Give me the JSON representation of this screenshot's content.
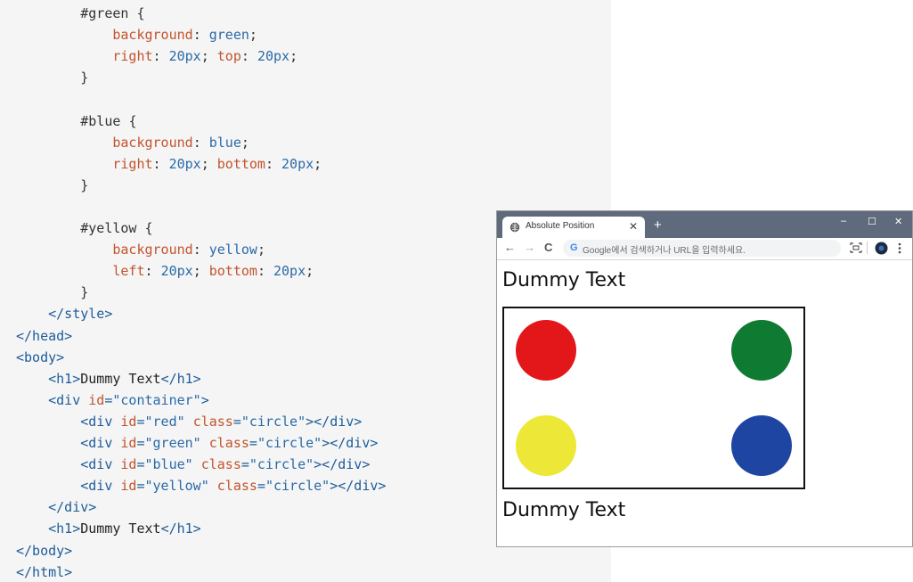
{
  "code": {
    "lines": [
      [
        [
          "tok-sel",
          "        #green "
        ],
        [
          "tok-punc",
          "{"
        ]
      ],
      [
        [
          "tok-prop",
          "            background"
        ],
        [
          "tok-punc",
          ": "
        ],
        [
          "tok-val",
          "green"
        ],
        [
          "tok-punc",
          ";"
        ]
      ],
      [
        [
          "tok-prop",
          "            right"
        ],
        [
          "tok-punc",
          ": "
        ],
        [
          "tok-val",
          "20px"
        ],
        [
          "tok-punc",
          "; "
        ],
        [
          "tok-prop",
          "top"
        ],
        [
          "tok-punc",
          ": "
        ],
        [
          "tok-val",
          "20px"
        ],
        [
          "tok-punc",
          ";"
        ]
      ],
      [
        [
          "tok-punc",
          "        }"
        ]
      ],
      [
        [
          "tok-punc",
          ""
        ]
      ],
      [
        [
          "tok-sel",
          "        #blue "
        ],
        [
          "tok-punc",
          "{"
        ]
      ],
      [
        [
          "tok-prop",
          "            background"
        ],
        [
          "tok-punc",
          ": "
        ],
        [
          "tok-val",
          "blue"
        ],
        [
          "tok-punc",
          ";"
        ]
      ],
      [
        [
          "tok-prop",
          "            right"
        ],
        [
          "tok-punc",
          ": "
        ],
        [
          "tok-val",
          "20px"
        ],
        [
          "tok-punc",
          "; "
        ],
        [
          "tok-prop",
          "bottom"
        ],
        [
          "tok-punc",
          ": "
        ],
        [
          "tok-val",
          "20px"
        ],
        [
          "tok-punc",
          ";"
        ]
      ],
      [
        [
          "tok-punc",
          "        }"
        ]
      ],
      [
        [
          "tok-punc",
          ""
        ]
      ],
      [
        [
          "tok-sel",
          "        #yellow "
        ],
        [
          "tok-punc",
          "{"
        ]
      ],
      [
        [
          "tok-prop",
          "            background"
        ],
        [
          "tok-punc",
          ": "
        ],
        [
          "tok-val",
          "yellow"
        ],
        [
          "tok-punc",
          ";"
        ]
      ],
      [
        [
          "tok-prop",
          "            left"
        ],
        [
          "tok-punc",
          ": "
        ],
        [
          "tok-val",
          "20px"
        ],
        [
          "tok-punc",
          "; "
        ],
        [
          "tok-prop",
          "bottom"
        ],
        [
          "tok-punc",
          ": "
        ],
        [
          "tok-val",
          "20px"
        ],
        [
          "tok-punc",
          ";"
        ]
      ],
      [
        [
          "tok-punc",
          "        }"
        ]
      ],
      [
        [
          "tok-tag",
          "    </style>"
        ]
      ],
      [
        [
          "tok-tag",
          "</head>"
        ]
      ],
      [
        [
          "tok-tag",
          "<body>"
        ]
      ],
      [
        [
          "tok-tag",
          "    <h1>"
        ],
        [
          "tok-text",
          "Dummy Text"
        ],
        [
          "tok-tag",
          "</h1>"
        ]
      ],
      [
        [
          "tok-tag",
          "    <div "
        ],
        [
          "tok-attr",
          "id"
        ],
        [
          "tok-tag",
          "="
        ],
        [
          "tok-str",
          "\"container\""
        ],
        [
          "tok-tag",
          ">"
        ]
      ],
      [
        [
          "tok-tag",
          "        <div "
        ],
        [
          "tok-attr",
          "id"
        ],
        [
          "tok-tag",
          "="
        ],
        [
          "tok-str",
          "\"red\""
        ],
        [
          "tok-tag",
          " "
        ],
        [
          "tok-attr",
          "class"
        ],
        [
          "tok-tag",
          "="
        ],
        [
          "tok-str",
          "\"circle\""
        ],
        [
          "tok-tag",
          "></div>"
        ]
      ],
      [
        [
          "tok-tag",
          "        <div "
        ],
        [
          "tok-attr",
          "id"
        ],
        [
          "tok-tag",
          "="
        ],
        [
          "tok-str",
          "\"green\""
        ],
        [
          "tok-tag",
          " "
        ],
        [
          "tok-attr",
          "class"
        ],
        [
          "tok-tag",
          "="
        ],
        [
          "tok-str",
          "\"circle\""
        ],
        [
          "tok-tag",
          "></div>"
        ]
      ],
      [
        [
          "tok-tag",
          "        <div "
        ],
        [
          "tok-attr",
          "id"
        ],
        [
          "tok-tag",
          "="
        ],
        [
          "tok-str",
          "\"blue\""
        ],
        [
          "tok-tag",
          " "
        ],
        [
          "tok-attr",
          "class"
        ],
        [
          "tok-tag",
          "="
        ],
        [
          "tok-str",
          "\"circle\""
        ],
        [
          "tok-tag",
          "></div>"
        ]
      ],
      [
        [
          "tok-tag",
          "        <div "
        ],
        [
          "tok-attr",
          "id"
        ],
        [
          "tok-tag",
          "="
        ],
        [
          "tok-str",
          "\"yellow\""
        ],
        [
          "tok-tag",
          " "
        ],
        [
          "tok-attr",
          "class"
        ],
        [
          "tok-tag",
          "="
        ],
        [
          "tok-str",
          "\"circle\""
        ],
        [
          "tok-tag",
          "></div>"
        ]
      ],
      [
        [
          "tok-tag",
          "    </div>"
        ]
      ],
      [
        [
          "tok-tag",
          "    <h1>"
        ],
        [
          "tok-text",
          "Dummy Text"
        ],
        [
          "tok-tag",
          "</h1>"
        ]
      ],
      [
        [
          "tok-tag",
          "</body>"
        ]
      ],
      [
        [
          "tok-tag",
          "</html>"
        ]
      ]
    ]
  },
  "browser": {
    "tab_title": "Absolute Position",
    "tab_close": "✕",
    "new_tab": "+",
    "win_minimize": "–",
    "win_maximize": "☐",
    "win_close": "✕",
    "nav_back": "←",
    "nav_forward": "→",
    "nav_reload": "C",
    "google_icon": "G",
    "omnibox_placeholder": "Google에서 검색하거나 URL을 입력하세요.",
    "heading_top": "Dummy Text",
    "heading_bottom": "Dummy Text",
    "circles": [
      {
        "name": "red-circle",
        "color": "#e3171a"
      },
      {
        "name": "green-circle",
        "color": "#0f7a32"
      },
      {
        "name": "yellow-circle",
        "color": "#ede838"
      },
      {
        "name": "blue-circle",
        "color": "#1f45a3"
      }
    ],
    "titlebar_color": "#5f6b7d"
  }
}
